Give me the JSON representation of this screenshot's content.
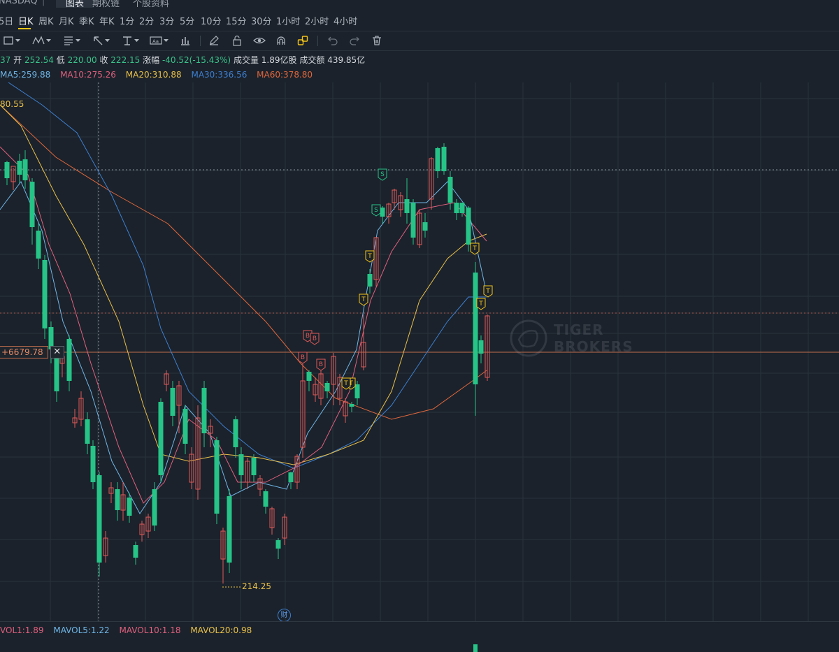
{
  "top_strip": {
    "exchange": "NASDAQ",
    "tabs": [
      "图表",
      "期权链",
      "个股资料"
    ],
    "active_tab": "图表"
  },
  "periods": [
    "5日",
    "日K",
    "周K",
    "月K",
    "季K",
    "年K",
    "1分",
    "2分",
    "3分",
    "5分",
    "10分",
    "15分",
    "30分",
    "1小时",
    "2小时",
    "4小时"
  ],
  "active_period": "日K",
  "toolbar_icons": [
    "rectangle-tool-icon",
    "pattern-tool-icon",
    "fibonacci-tool-icon",
    "arrow-tool-icon",
    "text-tool-icon",
    "label-tool-icon",
    "indicator-icon",
    "pencil-icon",
    "lock-icon",
    "eye-icon",
    "magnet-icon",
    "link-icon",
    "undo-icon",
    "redo-icon",
    "trash-icon"
  ],
  "quote": {
    "high_partial": "37",
    "open_label": "开",
    "open": "252.54",
    "low_label": "低",
    "low": "220.00",
    "close_label": "收",
    "close": "222.15",
    "change_label": "涨幅",
    "change": "-40.52(-15.43%)",
    "volume_label": "成交量",
    "volume": "1.89亿股",
    "amount_label": "成交额",
    "amount": "439.85亿"
  },
  "ma": [
    {
      "label": "MA5:259.88",
      "color": "#6fb5e6"
    },
    {
      "label": "MA10:275.26",
      "color": "#e0607e"
    },
    {
      "label": "MA20:310.88",
      "color": "#e8c04a"
    },
    {
      "label": "MA30:336.56",
      "color": "#3d7fd0"
    },
    {
      "label": "MA60:378.80",
      "color": "#e0673c"
    }
  ],
  "vol": [
    {
      "label": "VOL1:1.89",
      "color": "#e0607e"
    },
    {
      "label": "MAVOL5:1.22",
      "color": "#6fb5e6"
    },
    {
      "label": "MAVOL10:1.18",
      "color": "#e0607e"
    },
    {
      "label": "MAVOL20:0.98",
      "color": "#e8c04a"
    }
  ],
  "price_line_label": "+6679.78",
  "close_icon": "close-icon",
  "low_marker": "214.25",
  "high_marker_partial": "80.55",
  "financial_badge": "财",
  "watermark": {
    "line1": "TIGER",
    "line2": "BROKERS"
  },
  "colors": {
    "up": "#e05a5a",
    "down": "#26c487",
    "bg": "#1b222b",
    "grid": "#2a323c",
    "accent": "#f5c518"
  },
  "chart_data": {
    "type": "candlestick",
    "marks": [
      "B",
      "B",
      "B",
      "B",
      "S",
      "S",
      "T",
      "T",
      "T",
      "T",
      "T",
      "T",
      "T",
      "T"
    ]
  }
}
